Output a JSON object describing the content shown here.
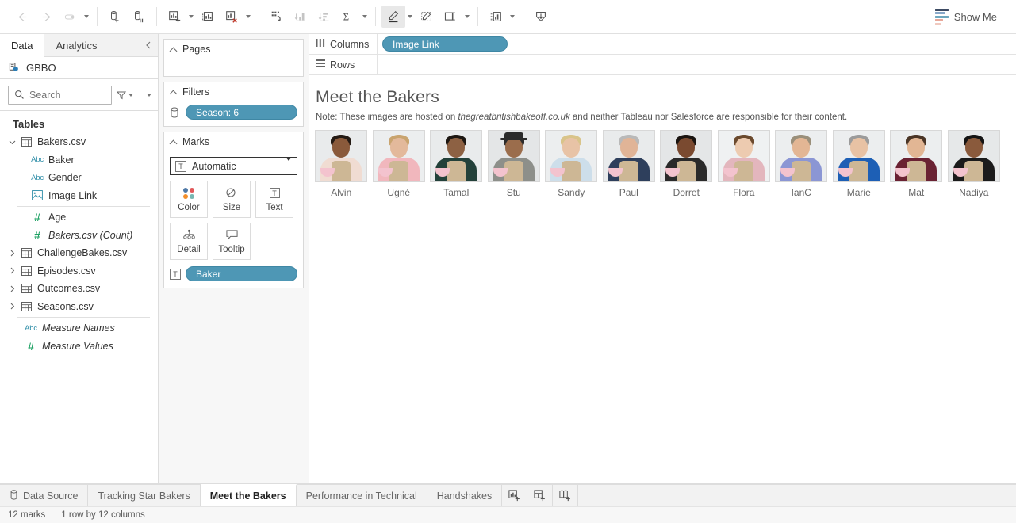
{
  "toolbar": {
    "left_buttons": [
      {
        "name": "back-button",
        "icon": "arrow-left-icon",
        "disabled": true
      },
      {
        "name": "forward-button",
        "icon": "arrow-right-icon",
        "disabled": true
      },
      {
        "name": "refresh-data-source-button",
        "icon": "refresh-icon",
        "disabled": true
      }
    ],
    "groups": [
      {
        "name": "data-group",
        "buttons": [
          "add-data-source-icon",
          "pause-auto-update-icon"
        ]
      },
      {
        "name": "worksheet-group",
        "buttons": [
          "new-worksheet-icon",
          "duplicate-sheet-icon",
          "clear-sheet-icon"
        ]
      },
      {
        "name": "sort-group",
        "buttons": [
          "swap-rows-columns-icon",
          "sort-ascending-icon",
          "sort-descending-icon",
          "totals-icon"
        ]
      },
      {
        "name": "annotate-group",
        "buttons": [
          "highlight-icon",
          "freeform-select-icon",
          "fit-icon"
        ]
      },
      {
        "name": "cards-group",
        "buttons": [
          "show-hide-cards-icon"
        ]
      },
      {
        "name": "download-group",
        "buttons": [
          "download-icon"
        ]
      }
    ],
    "show_me_label": "Show Me"
  },
  "data_pane": {
    "tabs": [
      {
        "label": "Data",
        "selected": true
      },
      {
        "label": "Analytics",
        "selected": false
      }
    ],
    "collapse_icon": "chevron-left-icon",
    "data_source": "GBBO",
    "search": {
      "placeholder": "Search",
      "value": ""
    },
    "section_title": "Tables",
    "tree": [
      {
        "label": "Bakers.csv",
        "type": "table",
        "expanded": true,
        "level": 1
      },
      {
        "label": "Baker",
        "type": "string",
        "level": 2
      },
      {
        "label": "Gender",
        "type": "string",
        "level": 2
      },
      {
        "label": "Image Link",
        "type": "image",
        "level": 2
      },
      {
        "label": "Age",
        "type": "number",
        "level": 2
      },
      {
        "label": "Bakers.csv (Count)",
        "type": "number",
        "level": 2,
        "italic": true
      },
      {
        "label": "ChallengeBakes.csv",
        "type": "table",
        "expanded": false,
        "level": 1
      },
      {
        "label": "Episodes.csv",
        "type": "table",
        "expanded": false,
        "level": 1
      },
      {
        "label": "Outcomes.csv",
        "type": "table",
        "expanded": false,
        "level": 1
      },
      {
        "label": "Seasons.csv",
        "type": "table",
        "expanded": false,
        "level": 1
      },
      {
        "label": "Measure Names",
        "type": "string",
        "level": 1,
        "italic": true,
        "noexp": true
      },
      {
        "label": "Measure Values",
        "type": "number",
        "level": 1,
        "italic": true,
        "noexp": true
      }
    ]
  },
  "cards": {
    "pages": {
      "title": "Pages",
      "items": []
    },
    "filters": {
      "title": "Filters",
      "items": [
        {
          "label": "Season: 6",
          "icon": "database-icon"
        }
      ]
    },
    "marks": {
      "title": "Marks",
      "mark_type": "Automatic",
      "mark_type_icon": "text-mark-icon",
      "buttons": [
        {
          "label": "Color",
          "icon": "color-palette-icon"
        },
        {
          "label": "Size",
          "icon": "size-icon"
        },
        {
          "label": "Text",
          "icon": "text-icon"
        },
        {
          "label": "Detail",
          "icon": "detail-icon"
        },
        {
          "label": "Tooltip",
          "icon": "tooltip-icon"
        }
      ],
      "pills": [
        {
          "label": "Baker",
          "icon": "text-mark-icon"
        }
      ]
    }
  },
  "shelves": {
    "columns": {
      "label": "Columns",
      "icon": "columns-icon",
      "pills": [
        "Image Link"
      ]
    },
    "rows": {
      "label": "Rows",
      "icon": "rows-icon",
      "pills": []
    }
  },
  "view": {
    "title": "Meet the Bakers",
    "note_prefix": "Note: These images are hosted on ",
    "note_link": "thegreatbritishbakeoff.co.uk",
    "note_suffix": " and neither Tableau nor Salesforce are responsible for their content.",
    "bakers": [
      {
        "name": "Alvin",
        "skin": "#8a5a3b",
        "hair": "#241a14",
        "shirt": "#f0dcd2",
        "bg": "#e9ebec"
      },
      {
        "name": "Ugné",
        "skin": "#e3b99b",
        "hair": "#c9a46f",
        "shirt": "#f1b7bd",
        "bg": "#eceeef"
      },
      {
        "name": "Tamal",
        "skin": "#8d6143",
        "hair": "#1d1712",
        "shirt": "#23413a",
        "bg": "#e9ebec"
      },
      {
        "name": "Stu",
        "skin": "#9b6d4c",
        "hair": "#2b2b2b",
        "shirt": "#8d8f8a",
        "bg": "#e4e6e7",
        "hat": true
      },
      {
        "name": "Sandy",
        "skin": "#e8c3a6",
        "hair": "#d9c48a",
        "shirt": "#cddeea",
        "bg": "#eceeef"
      },
      {
        "name": "Paul",
        "skin": "#e0b497",
        "hair": "#b9b9b9",
        "shirt": "#2e3f5c",
        "bg": "#e9ebec"
      },
      {
        "name": "Dorret",
        "skin": "#7a4a30",
        "hair": "#1a1410",
        "shirt": "#2a2a2a",
        "bg": "#e4e6e7"
      },
      {
        "name": "Flora",
        "skin": "#edcbb0",
        "hair": "#6b4a2e",
        "shirt": "#e3b6bd",
        "bg": "#eff1f2"
      },
      {
        "name": "IanC",
        "skin": "#e3b694",
        "hair": "#9a8f7a",
        "shirt": "#8b96d4",
        "bg": "#eceeef"
      },
      {
        "name": "Marie",
        "skin": "#e8c2a4",
        "hair": "#9b9b9b",
        "shirt": "#1d5fb5",
        "bg": "#eceeef"
      },
      {
        "name": "Mat",
        "skin": "#e2b694",
        "hair": "#4a3526",
        "shirt": "#6a2233",
        "bg": "#eceeef"
      },
      {
        "name": "Nadiya",
        "skin": "#8a5a3c",
        "hair": "#141414",
        "shirt": "#1b1b1b",
        "bg": "#e6e8e9"
      }
    ]
  },
  "bottom": {
    "tabs": [
      {
        "label": "Data Source",
        "icon": "data-source-icon",
        "selected": false
      },
      {
        "label": "Tracking Star Bakers",
        "selected": false
      },
      {
        "label": "Meet the Bakers",
        "selected": true
      },
      {
        "label": "Performance in Technical",
        "selected": false
      },
      {
        "label": "Handshakes",
        "selected": false
      }
    ],
    "add_buttons": [
      {
        "name": "new-worksheet-button",
        "icon": "new-worksheet-icon"
      },
      {
        "name": "new-dashboard-button",
        "icon": "new-dashboard-icon"
      },
      {
        "name": "new-story-button",
        "icon": "new-story-icon"
      }
    ],
    "status_marks": "12 marks",
    "status_shape": "1 row by 12 columns"
  },
  "colors": {
    "pill_blue": "#4e97b5",
    "accent_green": "#21a366",
    "accent_blue": "#2f8ea8"
  }
}
